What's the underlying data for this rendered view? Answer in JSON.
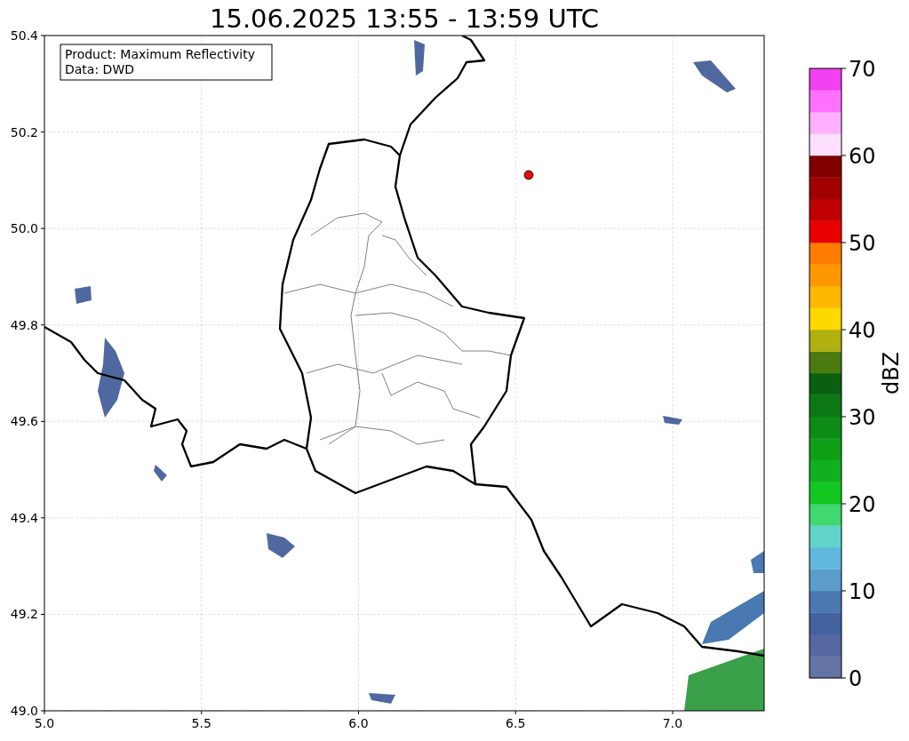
{
  "title": "15.06.2025 13:55 - 13:59 UTC",
  "legend": [
    "Product: Maximum Reflectivity",
    "Data: DWD"
  ],
  "x_axis": {
    "ticks": [
      "5.0",
      "5.5",
      "6.0",
      "6.5",
      "7.0"
    ]
  },
  "y_axis": {
    "ticks": [
      "50.4",
      "50.2",
      "50.0",
      "49.8",
      "49.6",
      "49.4",
      "49.2",
      "49.0"
    ]
  },
  "colorbar": {
    "label": "dBZ",
    "ticks": [
      "70",
      "60",
      "50",
      "40",
      "30",
      "20",
      "10",
      "0"
    ],
    "segments": [
      {
        "color": "#6474a4"
      },
      {
        "color": "#5568a0"
      },
      {
        "color": "#4462a0"
      },
      {
        "color": "#4a78b0"
      },
      {
        "color": "#5c9cc8"
      },
      {
        "color": "#60b8dc"
      },
      {
        "color": "#60d4c8"
      },
      {
        "color": "#40d870"
      },
      {
        "color": "#10c820"
      },
      {
        "color": "#10b020"
      },
      {
        "color": "#10a018"
      },
      {
        "color": "#0c8c14"
      },
      {
        "color": "#0c7814"
      },
      {
        "color": "#0a6010"
      },
      {
        "color": "#4a7a10"
      },
      {
        "color": "#b0b010"
      },
      {
        "color": "#ffd800"
      },
      {
        "color": "#ffb800"
      },
      {
        "color": "#ff9800"
      },
      {
        "color": "#ff7c00"
      },
      {
        "color": "#e80000"
      },
      {
        "color": "#c00000"
      },
      {
        "color": "#a00000"
      },
      {
        "color": "#800000"
      },
      {
        "color": "#ffe0ff"
      },
      {
        "color": "#ffb0ff"
      },
      {
        "color": "#ff70ff"
      },
      {
        "color": "#f040f0"
      }
    ]
  }
}
